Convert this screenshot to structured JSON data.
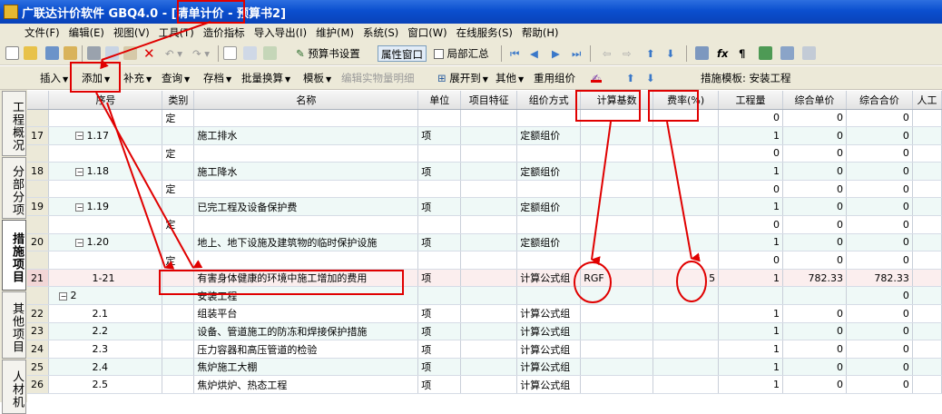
{
  "window": {
    "title_app": "广联达计价软件 GBQ4.0 - ",
    "title_mode": "[清单计价",
    "title_doc": " - 预算书2]"
  },
  "menu": [
    "文件(F)",
    "编辑(E)",
    "视图(V)",
    "工具(T)",
    "造价指标",
    "导入导出(I)",
    "维护(M)",
    "系统(S)",
    "窗口(W)",
    "在线服务(S)",
    "帮助(H)"
  ],
  "toolbar1": {
    "budget_setting": "预算书设置",
    "property_window": "属性窗口",
    "partial_summary": "局部汇总"
  },
  "toolbar2": {
    "insert": "插入",
    "add": "添加",
    "supplement": "补充",
    "query": "查询",
    "save": "存档",
    "batch_convert": "批量换算",
    "template": "模板",
    "edit_quantity": "编辑实物量明细",
    "expand_to": "展开到",
    "other": "其他",
    "reuse_price": "重用组价",
    "measure_template_label": "措施模板: 安装工程"
  },
  "side_tabs": [
    {
      "label": "工程概况",
      "active": false
    },
    {
      "label": "分部分项",
      "active": false
    },
    {
      "label": "措施项目",
      "active": true
    },
    {
      "label": "其他项目",
      "active": false
    },
    {
      "label": "人材机",
      "active": false
    }
  ],
  "columns": [
    "",
    "序号",
    "类别",
    "名称",
    "单位",
    "项目特征",
    "组价方式",
    "计算基数",
    "费率(%)",
    "工程量",
    "综合单价",
    "综合合价",
    "人工"
  ],
  "rows": [
    {
      "rn": "",
      "seq": "",
      "type": "定",
      "name": "",
      "unit": "",
      "feat": "",
      "method": "",
      "base": "",
      "rate": "",
      "qty": "0",
      "price": "0",
      "total": "0",
      "style": "plain",
      "node": "leaf"
    },
    {
      "rn": "17",
      "seq": "1.17",
      "type": "",
      "name": "施工排水",
      "unit": "项",
      "feat": "",
      "method": "定额组价",
      "base": "",
      "rate": "",
      "qty": "1",
      "price": "0",
      "total": "0",
      "style": "alt",
      "node": "minus"
    },
    {
      "rn": "",
      "seq": "",
      "type": "定",
      "name": "",
      "unit": "",
      "feat": "",
      "method": "",
      "base": "",
      "rate": "",
      "qty": "0",
      "price": "0",
      "total": "0",
      "style": "plain",
      "node": "leaf"
    },
    {
      "rn": "18",
      "seq": "1.18",
      "type": "",
      "name": "施工降水",
      "unit": "项",
      "feat": "",
      "method": "定额组价",
      "base": "",
      "rate": "",
      "qty": "1",
      "price": "0",
      "total": "0",
      "style": "alt",
      "node": "minus"
    },
    {
      "rn": "",
      "seq": "",
      "type": "定",
      "name": "",
      "unit": "",
      "feat": "",
      "method": "",
      "base": "",
      "rate": "",
      "qty": "0",
      "price": "0",
      "total": "0",
      "style": "plain",
      "node": "leaf"
    },
    {
      "rn": "19",
      "seq": "1.19",
      "type": "",
      "name": "已完工程及设备保护费",
      "unit": "项",
      "feat": "",
      "method": "定额组价",
      "base": "",
      "rate": "",
      "qty": "1",
      "price": "0",
      "total": "0",
      "style": "alt",
      "node": "minus"
    },
    {
      "rn": "",
      "seq": "",
      "type": "定",
      "name": "",
      "unit": "",
      "feat": "",
      "method": "",
      "base": "",
      "rate": "",
      "qty": "0",
      "price": "0",
      "total": "0",
      "style": "plain",
      "node": "leaf"
    },
    {
      "rn": "20",
      "seq": "1.20",
      "type": "",
      "name": "地上、地下设施及建筑物的临时保护设施",
      "unit": "项",
      "feat": "",
      "method": "定额组价",
      "base": "",
      "rate": "",
      "qty": "1",
      "price": "0",
      "total": "0",
      "style": "alt",
      "node": "minus"
    },
    {
      "rn": "",
      "seq": "",
      "type": "定",
      "name": "",
      "unit": "",
      "feat": "",
      "method": "",
      "base": "",
      "rate": "",
      "qty": "0",
      "price": "0",
      "total": "0",
      "style": "plain",
      "node": "leaf"
    },
    {
      "rn": "21",
      "seq": "1-21",
      "type": "",
      "name": "有害身体健康的环境中施工增加的费用",
      "unit": "项",
      "feat": "",
      "method": "计算公式组",
      "base": "RGF",
      "rate": "5",
      "qty": "1",
      "price": "782.33",
      "total": "782.33",
      "style": "sel",
      "node": "leaf"
    },
    {
      "rn": "",
      "seq": "2",
      "type": "",
      "name": "安装工程",
      "unit": "",
      "feat": "",
      "method": "",
      "base": "",
      "rate": "",
      "qty": "",
      "price": "",
      "total": "0",
      "style": "alt",
      "node": "top"
    },
    {
      "rn": "22",
      "seq": "2.1",
      "type": "",
      "name": "组装平台",
      "unit": "项",
      "feat": "",
      "method": "计算公式组",
      "base": "",
      "rate": "",
      "qty": "1",
      "price": "0",
      "total": "0",
      "style": "plain",
      "node": "leaf"
    },
    {
      "rn": "23",
      "seq": "2.2",
      "type": "",
      "name": "设备、管道施工的防冻和焊接保护措施",
      "unit": "项",
      "feat": "",
      "method": "计算公式组",
      "base": "",
      "rate": "",
      "qty": "1",
      "price": "0",
      "total": "0",
      "style": "alt",
      "node": "leaf"
    },
    {
      "rn": "24",
      "seq": "2.3",
      "type": "",
      "name": "压力容器和高压管道的检验",
      "unit": "项",
      "feat": "",
      "method": "计算公式组",
      "base": "",
      "rate": "",
      "qty": "1",
      "price": "0",
      "total": "0",
      "style": "plain",
      "node": "leaf"
    },
    {
      "rn": "25",
      "seq": "2.4",
      "type": "",
      "name": "焦炉施工大棚",
      "unit": "项",
      "feat": "",
      "method": "计算公式组",
      "base": "",
      "rate": "",
      "qty": "1",
      "price": "0",
      "total": "0",
      "style": "alt",
      "node": "leaf"
    },
    {
      "rn": "26",
      "seq": "2.5",
      "type": "",
      "name": "焦炉烘炉、热态工程",
      "unit": "项",
      "feat": "",
      "method": "计算公式组",
      "base": "",
      "rate": "",
      "qty": "1",
      "price": "0",
      "total": "0",
      "style": "plain",
      "node": "leaf"
    }
  ],
  "colors": {
    "annotation": "#e00000",
    "title_bar": "#0b4fcf",
    "alt_row": "#eff9f7",
    "selected_row": "#fbeeee"
  }
}
